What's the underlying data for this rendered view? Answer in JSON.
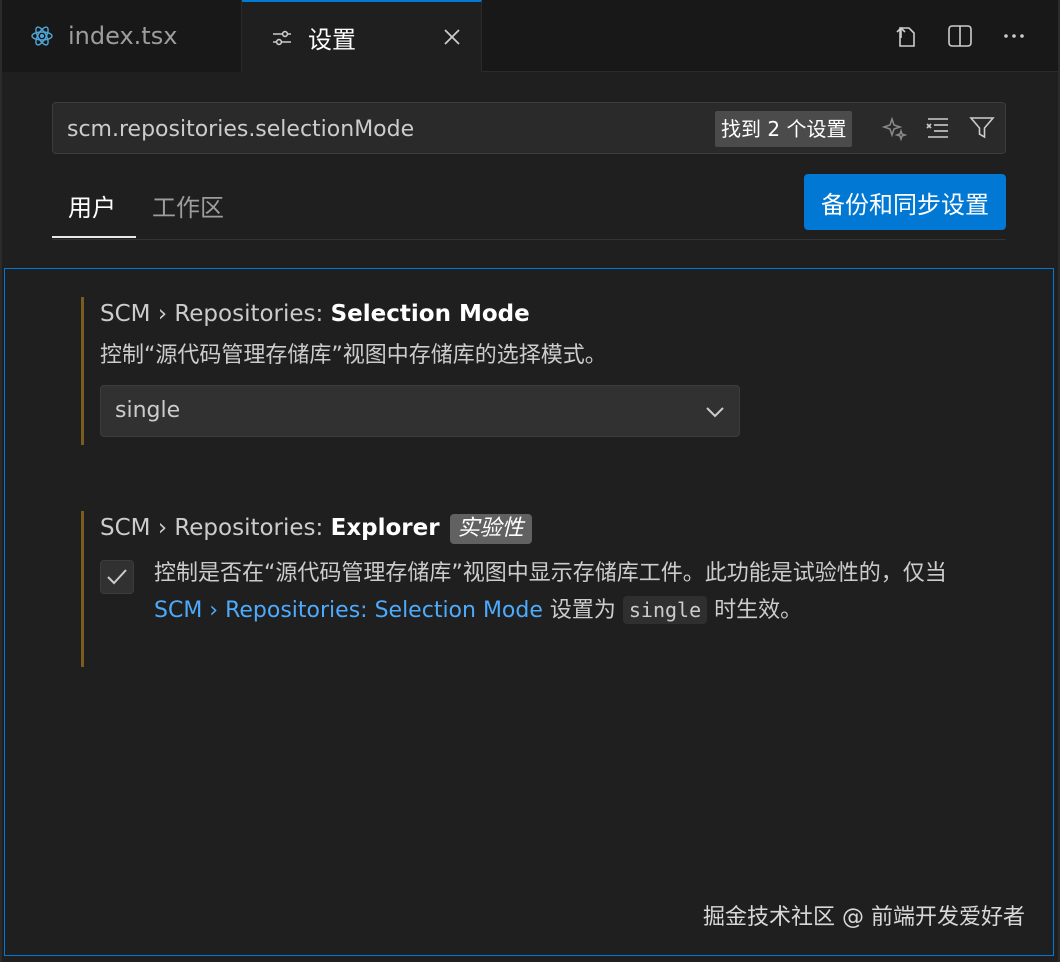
{
  "tabs": [
    {
      "label": "index.tsx",
      "icon": "react-icon"
    },
    {
      "label": "设置",
      "icon": "settings-sliders-icon",
      "close_icon": "close-icon"
    }
  ],
  "tab_actions": [
    "open-settings-json-icon",
    "split-editor-icon",
    "more-actions-icon"
  ],
  "search": {
    "value": "scm.repositories.selectionMode",
    "result_count": "找到 2 个设置",
    "tools": [
      "ai-search-icon",
      "clear-filter-icon",
      "filter-icon"
    ]
  },
  "scope_tabs": {
    "user": "用户",
    "workspace": "工作区"
  },
  "backup_button": "备份和同步设置",
  "settings": {
    "selection_mode": {
      "category": "SCM › Repositories: ",
      "name": "Selection Mode",
      "description": "控制“源代码管理存储库”视图中存储库的选择模式。",
      "value": "single"
    },
    "explorer": {
      "category": "SCM › Repositories: ",
      "name": "Explorer",
      "tag": "实验性",
      "checked": true,
      "desc_before": "控制是否在“源代码管理存储库”视图中显示存储库工件。此功能是试验性的，仅当 ",
      "link": "SCM › Repositories: Selection Mode",
      "desc_middle": " 设置为 ",
      "code": "single",
      "desc_after": " 时生效。"
    }
  },
  "watermark": "掘金技术社区 @ 前端开发爱好者",
  "colors": {
    "accent": "#0078d4",
    "modified_bar": "#7a5c1e",
    "link": "#4daafc"
  }
}
